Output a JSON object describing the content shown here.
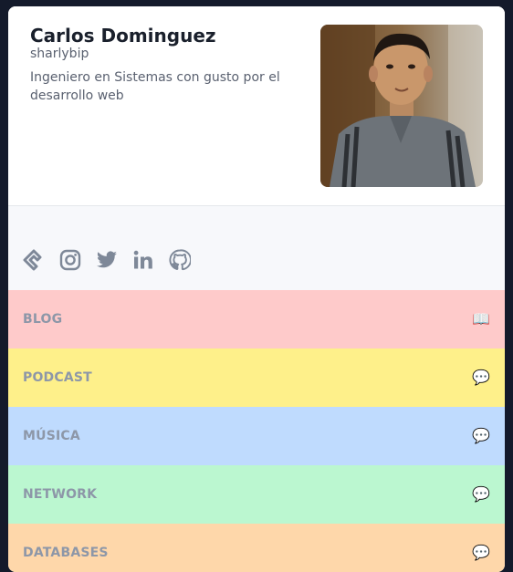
{
  "profile": {
    "name": "Carlos Dominguez",
    "handle": "sharlybip",
    "bio": "Ingeniero en Sistemas con gusto por el desarrollo web",
    "avatar_alt": "Carlos Dominguez"
  },
  "social": [
    {
      "icon": "dev-diamond-icon",
      "label": "Blog"
    },
    {
      "icon": "instagram-icon",
      "label": "Instagram"
    },
    {
      "icon": "twitter-icon",
      "label": "Twitter"
    },
    {
      "icon": "linkedin-icon",
      "label": "LinkedIn"
    },
    {
      "icon": "github-icon",
      "label": "GitHub"
    }
  ],
  "links": [
    {
      "label": "BLOG",
      "icon": "open-book-icon",
      "glyph": "📖",
      "color": "#fecaca"
    },
    {
      "label": "PODCAST",
      "icon": "speech-bubble-icon",
      "glyph": "💬",
      "color": "#fef08a"
    },
    {
      "label": "MÚSICA",
      "icon": "speech-bubble-icon",
      "glyph": "💬",
      "color": "#bfdbfe"
    },
    {
      "label": "NETWORK",
      "icon": "speech-bubble-icon",
      "glyph": "💬",
      "color": "#bbf7d0"
    },
    {
      "label": "DATABASES",
      "icon": "speech-bubble-icon",
      "glyph": "💬",
      "color": "#fed7aa"
    }
  ],
  "colors": {
    "page_background": "#141a2b",
    "card_background": "#ffffff",
    "social_background": "#f7f8fb",
    "icon_gray": "#7e8898"
  }
}
